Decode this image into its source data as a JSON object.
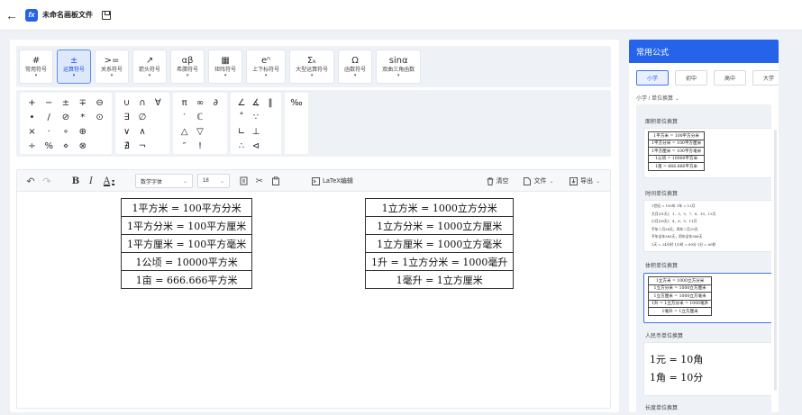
{
  "app": {
    "title": "未命名画板文件"
  },
  "tabs": [
    {
      "icon": "#",
      "label": "常用符号",
      "active": false
    },
    {
      "icon": "±",
      "label": "运算符号",
      "active": true
    },
    {
      "icon": ">=",
      "label": "关系符号",
      "active": false
    },
    {
      "icon": "↗",
      "label": "箭头符号",
      "active": false
    },
    {
      "icon": "αβ",
      "label": "希腊符号",
      "active": false
    },
    {
      "icon": "▦",
      "label": "矩阵符号",
      "active": false
    },
    {
      "icon": "eⁿ",
      "label": "上下标符号",
      "active": false
    },
    {
      "icon": "Σₖ",
      "label": "大型运算符号",
      "active": false
    },
    {
      "icon": "Ω",
      "label": "函数符号",
      "active": false
    },
    {
      "icon": "sinα",
      "label": "双曲三角函数",
      "active": false
    }
  ],
  "symbols": {
    "g1": [
      "+",
      "−",
      "±",
      "∓",
      "⊖",
      "•",
      "/",
      "⊘",
      "*",
      "⊙",
      "×",
      "·",
      "∘",
      "⊕",
      "",
      "÷",
      "%",
      "⋄",
      "⊗",
      ""
    ],
    "g2": [
      "∪",
      "∩",
      "∀",
      "∃",
      "∅",
      "",
      "∨",
      "∧",
      "",
      "∄",
      "¬",
      ""
    ],
    "g3": [
      "π",
      "∞",
      "∂",
      "′",
      "ℂ",
      "",
      "△",
      "▽",
      "",
      "″",
      "!",
      ""
    ],
    "g4": [
      "∠",
      "∡",
      "‖",
      "˚",
      "∵",
      "",
      "∟",
      "⊥",
      "",
      "∴",
      "⊲",
      ""
    ],
    "g5": [
      "‰"
    ]
  },
  "toolbar": {
    "font": "数学字体",
    "size": "18",
    "latex": "LaTeX编辑",
    "clear": "清空",
    "file": "文件",
    "export": "导出"
  },
  "canvas": {
    "area_table": [
      "1平方米 = 100平方分米",
      "1平方分米 = 100平方厘米",
      "1平方厘米 = 100平方毫米",
      "1公顷 = 10000平方米",
      "1亩 = 666.666平方米"
    ],
    "volume_table": [
      "1立方米 = 1000立方分米",
      "1立方分米 = 1000立方厘米",
      "1立方厘米 = 1000立方毫米",
      "1升 = 1立方分米 = 1000毫升",
      "1毫升 = 1立方厘米"
    ]
  },
  "sidebar": {
    "header": "常用公式",
    "levels": [
      "小学",
      "初中",
      "高中",
      "大学"
    ],
    "active_level": "小学",
    "breadcrumb": "小学 / 单位换算",
    "sections": [
      {
        "title": "面积单位换算",
        "lines": [
          "1平方米 = 100平方分米",
          "1平方分米 = 100平方厘米",
          "1平方厘米 = 100平方毫米",
          "1公顷 = 10000平方米",
          "1亩 = 666.666平方米"
        ]
      },
      {
        "title": "时间单位换算",
        "lines": [
          "1世纪 = 100年  1年 = 12月",
          "大月(31天)：1、3、5、7、8、10、12月",
          "小月(30天)：4、6、9、11月",
          "平年二月28天，闰年二月29天",
          "平年全年365天，闰年全年366天",
          "1天 = 24小时  1小时 = 60分  1分 = 60秒"
        ]
      },
      {
        "title": "体积单位换算",
        "lines": [
          "1立方米 = 1000立方分米",
          "1立方分米 = 1000立方厘米",
          "1立方厘米 = 1000立方毫米",
          "1升 = 1立方分米 = 1000毫升",
          "1毫升 = 1立方厘米"
        ]
      },
      {
        "title": "人民币单位换算",
        "lines": [
          "1元 = 10角",
          "1角 = 10分"
        ]
      },
      {
        "title": "长度单位换算",
        "lines": []
      }
    ]
  }
}
